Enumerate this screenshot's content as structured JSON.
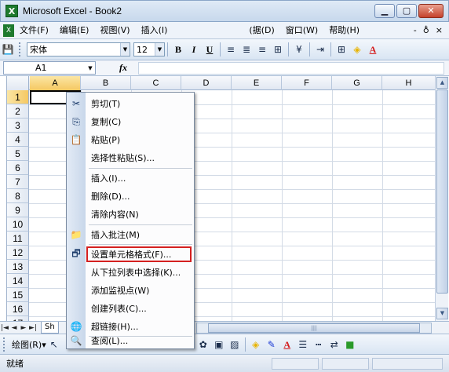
{
  "window": {
    "title": "Microsoft Excel - Book2",
    "app_icon": "X",
    "buttons": [
      "minimize",
      "maximize",
      "close"
    ]
  },
  "menubar": {
    "items": [
      "文件(F)",
      "编辑(E)",
      "视图(V)",
      "插入(I)"
    ],
    "trailing": [
      "(据(D)",
      "窗口(W)",
      "帮助(H)"
    ],
    "doc_controls": [
      "-",
      "♁",
      "×"
    ]
  },
  "toolbar": {
    "font_name": "宋体",
    "font_size": "12",
    "bold": "B",
    "italic": "I",
    "underline": "U",
    "font_color_glyph": "A"
  },
  "formula_bar": {
    "name_box": "A1",
    "fx_label": "fx",
    "value": ""
  },
  "grid": {
    "columns": [
      "A",
      "B",
      "C",
      "D",
      "E",
      "F",
      "G",
      "H"
    ],
    "rows": [
      "1",
      "2",
      "3",
      "4",
      "5",
      "6",
      "7",
      "8",
      "9",
      "10",
      "11",
      "12",
      "13",
      "14",
      "15",
      "16",
      "17"
    ],
    "active_cell": "A1"
  },
  "sheet_tabs": {
    "nav": [
      "|◄",
      "◄",
      "►",
      "►|"
    ],
    "visible_tab": "Sh"
  },
  "draw_toolbar": {
    "label": "绘图(R)▾"
  },
  "status": {
    "text": "就绪"
  },
  "context_menu": {
    "items": [
      {
        "icon": "scissors-icon",
        "glyph": "✂",
        "label": "剪切(T)"
      },
      {
        "icon": "copy-icon",
        "glyph": "⎘",
        "label": "复制(C)"
      },
      {
        "icon": "paste-icon",
        "glyph": "📋",
        "label": "粘贴(P)"
      },
      {
        "icon": "",
        "glyph": "",
        "label": "选择性粘贴(S)..."
      },
      {
        "icon": "",
        "glyph": "",
        "label": "插入(I)..."
      },
      {
        "icon": "",
        "glyph": "",
        "label": "删除(D)..."
      },
      {
        "icon": "",
        "glyph": "",
        "label": "清除内容(N)"
      },
      {
        "icon": "comment-icon",
        "glyph": "📁",
        "label": "插入批注(M)"
      },
      {
        "icon": "format-cells-icon",
        "glyph": "🗗",
        "label": "设置单元格格式(F)..."
      },
      {
        "icon": "",
        "glyph": "",
        "label": "从下拉列表中选择(K)..."
      },
      {
        "icon": "",
        "glyph": "",
        "label": "添加监视点(W)"
      },
      {
        "icon": "",
        "glyph": "",
        "label": "创建列表(C)..."
      },
      {
        "icon": "hyperlink-icon",
        "glyph": "🌐",
        "label": "超链接(H)..."
      },
      {
        "icon": "lookup-icon",
        "glyph": "🔍",
        "label": "查阅(L)..."
      }
    ],
    "highlighted_index": 8
  }
}
